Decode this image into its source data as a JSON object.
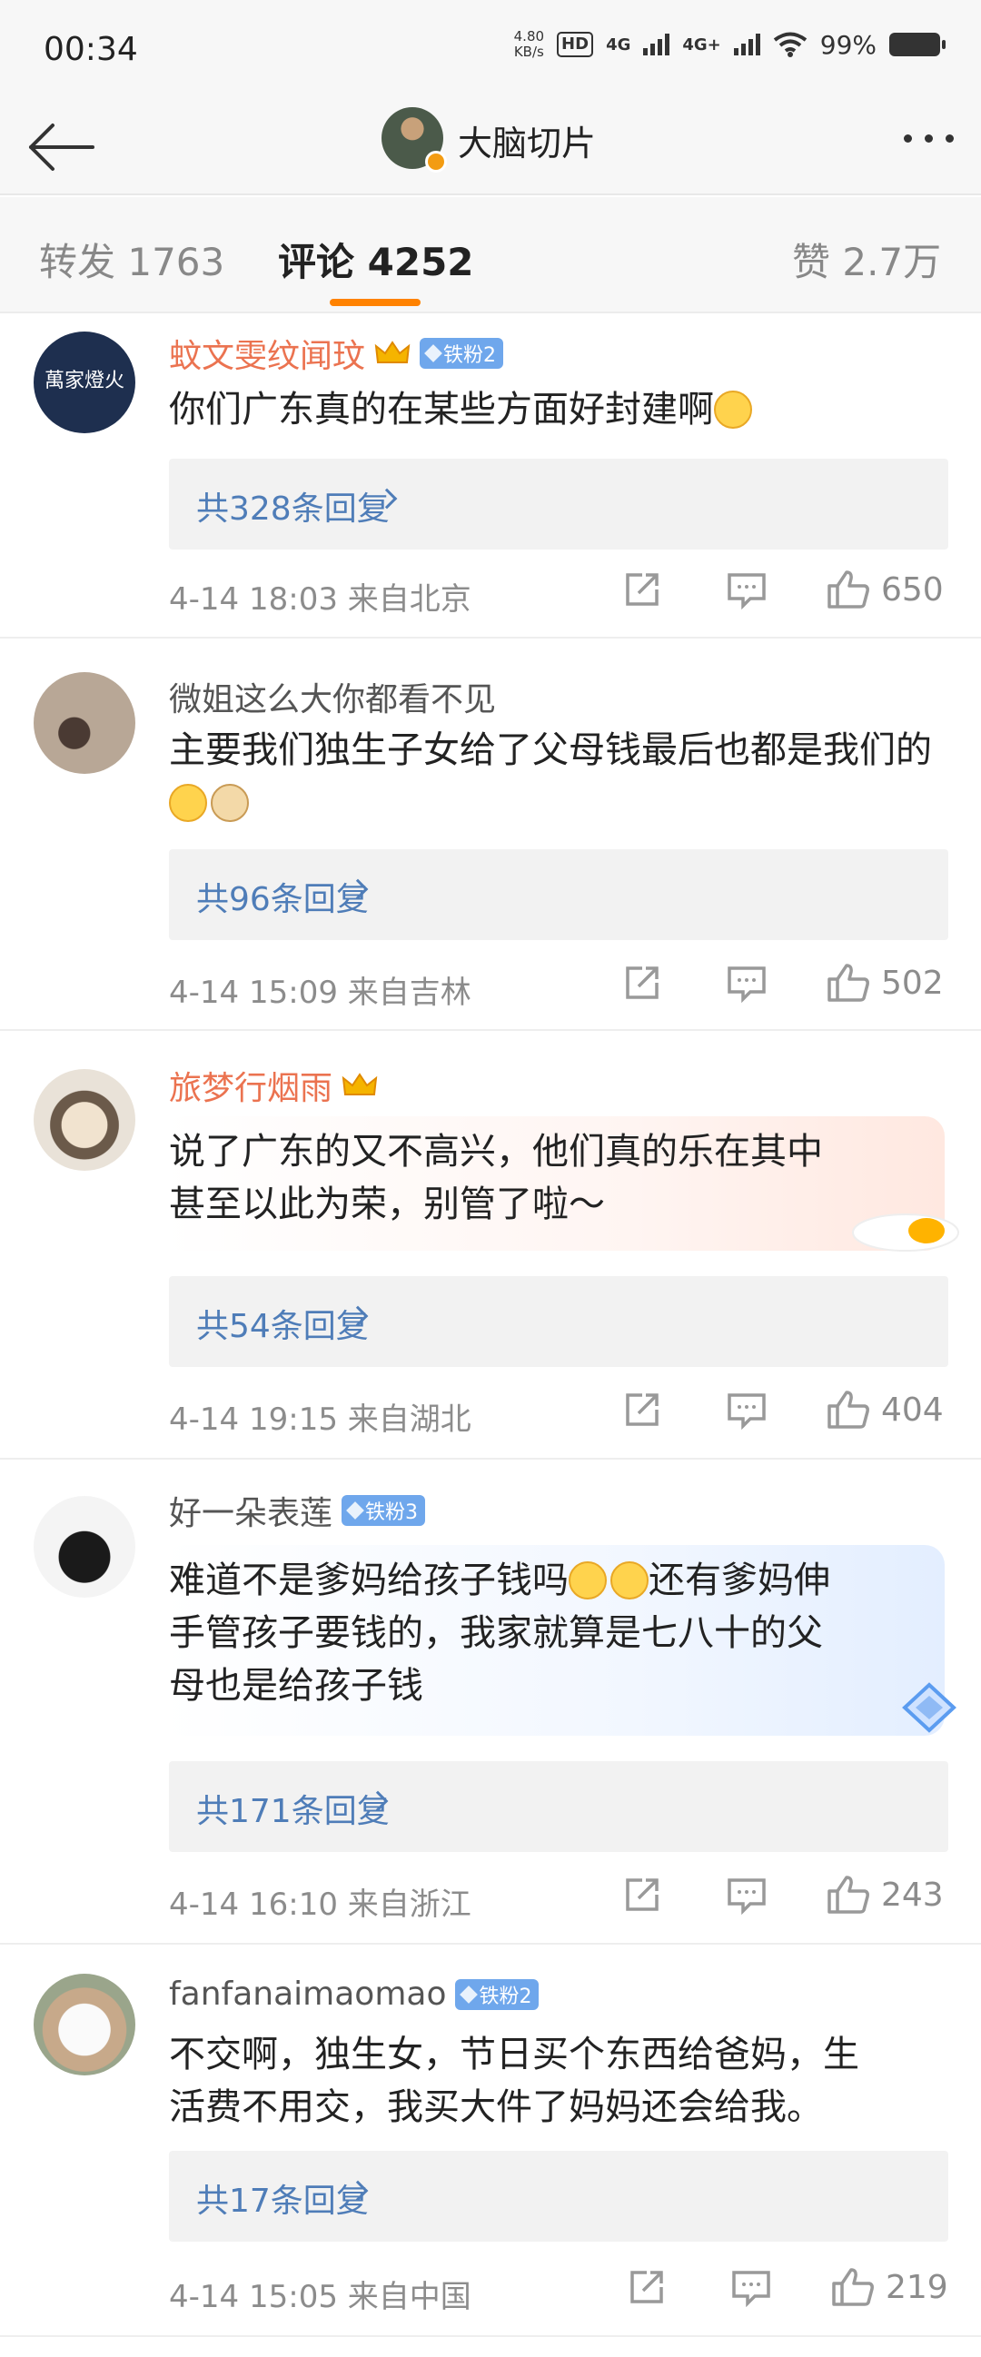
{
  "status_bar": {
    "time": "00:34",
    "net_speed_value": "4.80",
    "net_speed_unit": "KB/s",
    "hd_label": "HD",
    "net_type_1": "4G",
    "net_type_2": "4G+",
    "battery": "99%"
  },
  "header": {
    "title": "大脑切片"
  },
  "tabs": [
    {
      "label": "转发 1763"
    },
    {
      "label": "评论 4252"
    },
    {
      "label": "赞 2.7万"
    }
  ],
  "comments": [
    {
      "username": "蚊文雯纹闻玟",
      "fan_badge": "铁粉2",
      "text": "你们广东真的在某些方面好封建啊",
      "replies": "共328条回复",
      "meta": "4-14 18:03 来自北京",
      "likes": "650",
      "avatar_text": "萬家燈火"
    },
    {
      "username": "微姐这么大你都看不见",
      "text": "主要我们独生子女给了父母钱最后也都是我们的",
      "replies": "共96条回复",
      "meta": "4-14 15:09 来自吉林",
      "likes": "502"
    },
    {
      "username": "旅梦行烟雨",
      "text_line1": "说了广东的又不高兴，他们真的乐在其中",
      "text_line2": "甚至以此为荣，别管了啦～",
      "replies": "共54条回复",
      "meta": "4-14 19:15 来自湖北",
      "likes": "404"
    },
    {
      "username": "好一朵表莲",
      "fan_badge": "铁粉3",
      "text_line1_a": "难道不是爹妈给孩子钱吗",
      "text_line1_b": "还有爹妈伸",
      "text_line2": "手管孩子要钱的，我家就算是七八十的父",
      "text_line3": "母也是给孩子钱",
      "replies": "共171条回复",
      "meta": "4-14 16:10 来自浙江",
      "likes": "243"
    },
    {
      "username": "fanfanaimaomao",
      "fan_badge": "铁粉2",
      "text_line1": "不交啊，独生女，节日买个东西给爸妈，生",
      "text_line2": "活费不用交，我买大件了妈妈还会给我。",
      "replies": "共17条回复",
      "meta": "4-14 15:05 来自中国",
      "likes": "219"
    }
  ],
  "colors": {
    "accent": "#ff8200",
    "username_orange": "#eb7350",
    "reply_link": "#4f7db8",
    "fan_badge": "#6fa7ec"
  }
}
